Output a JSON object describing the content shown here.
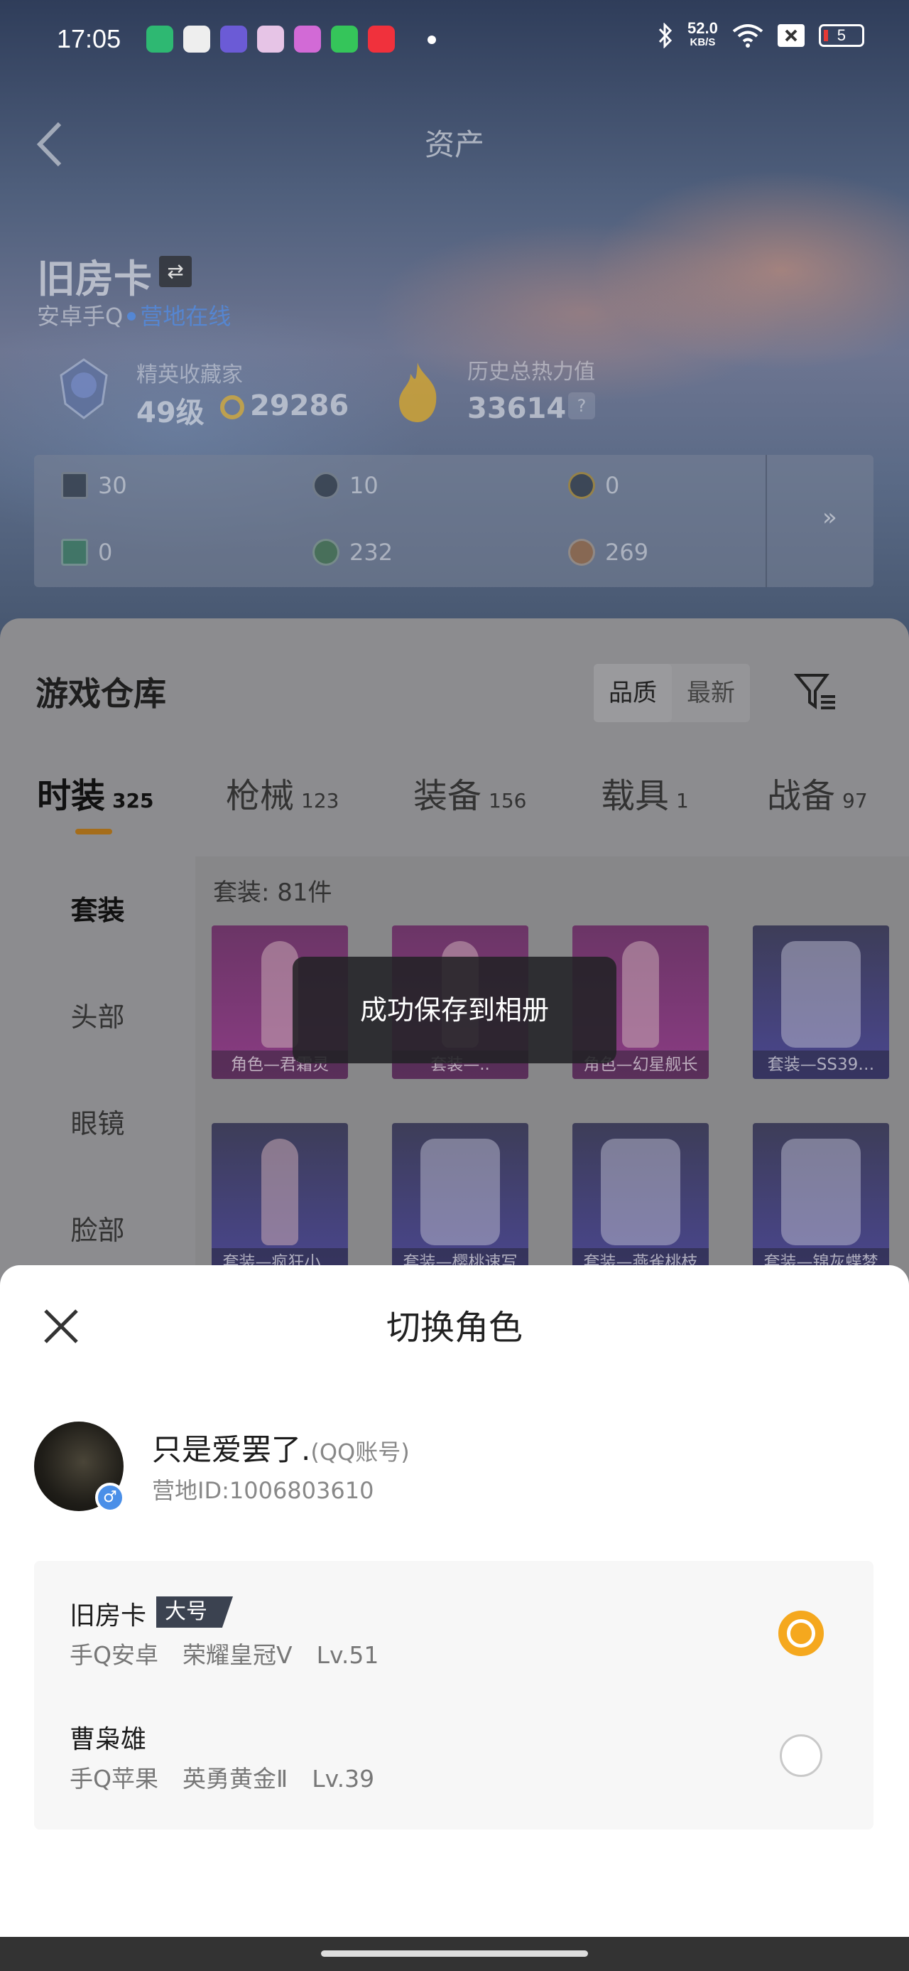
{
  "status_bar": {
    "time": "17:05",
    "speed_value": "52.0",
    "speed_unit": "KB/S",
    "battery": "5"
  },
  "header": {
    "title": "资产"
  },
  "profile": {
    "role_name": "旧房卡",
    "platform": "安卓手Q",
    "online_status": "营地在线",
    "collector_label": "精英收藏家",
    "collector_level": "49级",
    "coins": "29286",
    "heat_label": "历史总热力值",
    "heat_value": "33614"
  },
  "resources": [
    {
      "icon": "card-icon",
      "value": "30"
    },
    {
      "icon": "gear-coin-icon",
      "value": "10"
    },
    {
      "icon": "a-coin-icon",
      "value": "0"
    },
    {
      "icon": "green-card-icon",
      "value": "0"
    },
    {
      "icon": "green-coin-icon",
      "value": "232"
    },
    {
      "icon": "bronze-coin-icon",
      "value": "269"
    }
  ],
  "warehouse": {
    "title": "游戏仓库",
    "sort_options": [
      "品质",
      "最新"
    ],
    "tabs": [
      {
        "label": "时装",
        "count": "325"
      },
      {
        "label": "枪械",
        "count": "123"
      },
      {
        "label": "装备",
        "count": "156"
      },
      {
        "label": "载具",
        "count": "1"
      },
      {
        "label": "战备",
        "count": "97"
      }
    ],
    "side_categories": [
      "套装",
      "头部",
      "眼镜",
      "脸部"
    ],
    "set_count": "套装: 81件",
    "items": [
      {
        "caption": "角色—君霜灵",
        "color": "purple"
      },
      {
        "caption": "套装—..",
        "color": "purple"
      },
      {
        "caption": "角色—幻星舰长",
        "color": "purple"
      },
      {
        "caption": "套装—SS39…",
        "color": "blue"
      },
      {
        "caption": "套装—疯狂小…",
        "color": "blue"
      },
      {
        "caption": "套装—樱桃速写",
        "color": "blue"
      },
      {
        "caption": "套装—燕雀桃枝",
        "color": "blue"
      },
      {
        "caption": "套装—锦灰蝶梦",
        "color": "blue"
      }
    ]
  },
  "toast": {
    "message": "成功保存到相册"
  },
  "switch_sheet": {
    "title": "切换角色",
    "user_name": "只是爱罢了.",
    "account_type": "(QQ账号)",
    "camp_id": "营地ID:1006803610",
    "roles": [
      {
        "name": "旧房卡",
        "badge": "大号",
        "platform": "手Q安卓",
        "rank": "荣耀皇冠Ⅴ",
        "level": "Lv.51",
        "selected": true
      },
      {
        "name": "曹枭雄",
        "badge": "",
        "platform": "手Q苹果",
        "rank": "英勇黄金Ⅱ",
        "level": "Lv.39",
        "selected": false
      }
    ],
    "accent_color": "#f5a81e"
  }
}
